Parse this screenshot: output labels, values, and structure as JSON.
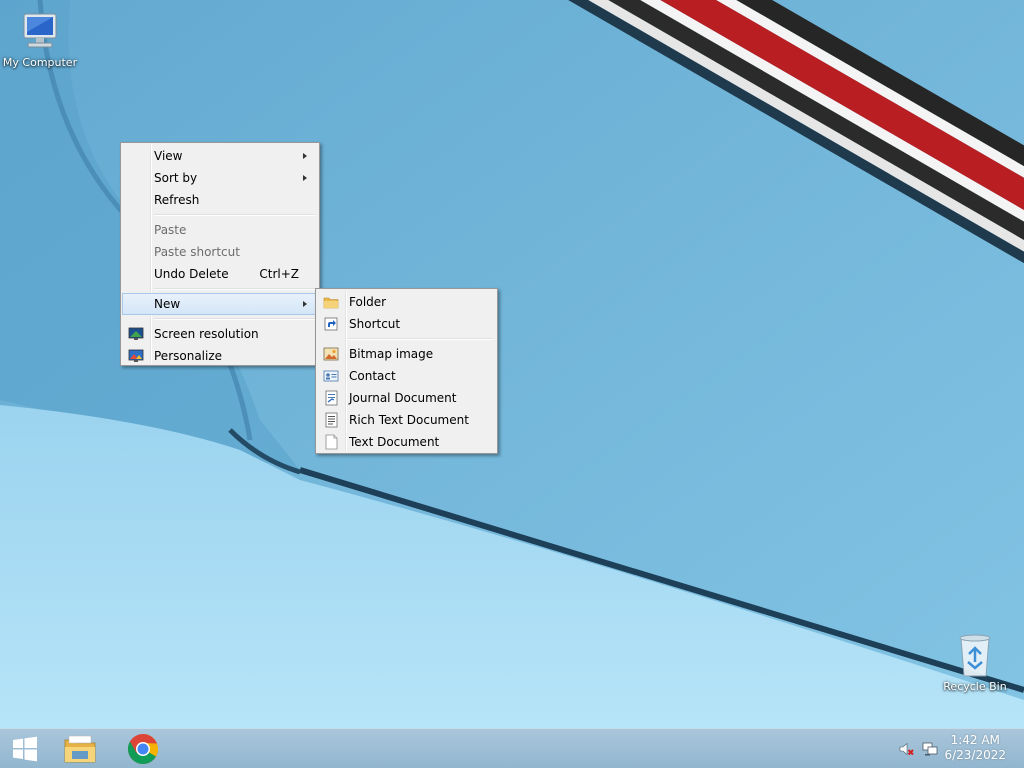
{
  "desktop": {
    "icons": [
      {
        "label": "My Computer",
        "icon": "computer-icon"
      },
      {
        "label": "Recycle Bin",
        "icon": "recycle-bin-icon"
      }
    ]
  },
  "context_menu": {
    "items": [
      {
        "label": "View",
        "submenu": true
      },
      {
        "label": "Sort by",
        "submenu": true
      },
      {
        "label": "Refresh"
      },
      {
        "label": "Paste",
        "disabled": true
      },
      {
        "label": "Paste shortcut",
        "disabled": true
      },
      {
        "label": "Undo Delete",
        "shortcut": "Ctrl+Z"
      },
      {
        "label": "New",
        "submenu": true,
        "highlighted": true
      },
      {
        "label": "Screen resolution",
        "icon": "screen-resolution-icon"
      },
      {
        "label": "Personalize",
        "icon": "personalize-icon"
      }
    ]
  },
  "new_submenu": {
    "items": [
      {
        "label": "Folder",
        "icon": "folder-icon"
      },
      {
        "label": "Shortcut",
        "icon": "shortcut-icon"
      },
      {
        "label": "Bitmap image",
        "icon": "bitmap-image-icon"
      },
      {
        "label": "Contact",
        "icon": "contact-icon"
      },
      {
        "label": "Journal Document",
        "icon": "journal-document-icon"
      },
      {
        "label": "Rich Text Document",
        "icon": "rich-text-document-icon"
      },
      {
        "label": "Text Document",
        "icon": "text-document-icon"
      }
    ]
  },
  "taskbar": {
    "buttons": [
      {
        "name": "start",
        "icon": "windows-logo-icon"
      },
      {
        "name": "file-explorer",
        "icon": "file-explorer-icon"
      },
      {
        "name": "chrome",
        "icon": "chrome-icon"
      }
    ],
    "tray": [
      {
        "icon": "volume-muted-icon"
      },
      {
        "icon": "network-icon"
      }
    ],
    "clock": {
      "time": "1:42 AM",
      "date": "6/23/2022"
    }
  },
  "colors": {
    "menu_bg": "#f0f0f0",
    "menu_highlight": "#d4e6f8",
    "taskbar": "#9fbfd5",
    "wallpaper": "#7cc0e2"
  }
}
